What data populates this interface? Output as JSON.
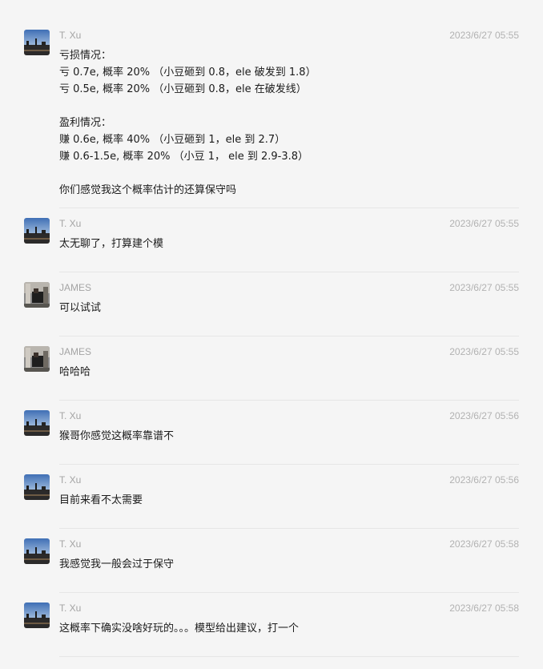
{
  "colors": {
    "background": "#f5f5f5",
    "meta_text": "#a4a4a4",
    "message_text": "#1b1b1b",
    "divider": "#e6e6e6"
  },
  "messages": [
    {
      "sender": "T. Xu",
      "avatar": "txu-avatar",
      "time": "2023/6/27 05:55",
      "lines": [
        "亏损情况：",
        "亏 0.7e, 概率 20% （小豆砸到 0.8，ele 破发到 1.8）",
        "亏 0.5e, 概率 20% （小豆砸到 0.8，ele 在破发线）",
        "",
        "盈利情况：",
        "赚 0.6e, 概率 40% （小豆砸到 1，ele 到 2.7）",
        "赚 0.6-1.5e, 概率 20% （小豆 1， ele 到 2.9-3.8）",
        "",
        "你们感觉我这个概率估计的还算保守吗"
      ]
    },
    {
      "sender": "T. Xu",
      "avatar": "txu-avatar",
      "time": "2023/6/27 05:55",
      "lines": [
        "太无聊了，打算建个模"
      ]
    },
    {
      "sender": "JAMES",
      "avatar": "james-avatar",
      "time": "2023/6/27 05:55",
      "lines": [
        "可以试试"
      ]
    },
    {
      "sender": "JAMES",
      "avatar": "james-avatar",
      "time": "2023/6/27 05:55",
      "lines": [
        "哈哈哈"
      ]
    },
    {
      "sender": "T. Xu",
      "avatar": "txu-avatar",
      "time": "2023/6/27 05:56",
      "lines": [
        "猴哥你感觉这概率靠谱不"
      ]
    },
    {
      "sender": "T. Xu",
      "avatar": "txu-avatar",
      "time": "2023/6/27 05:56",
      "lines": [
        "目前来看不太需要"
      ]
    },
    {
      "sender": "T. Xu",
      "avatar": "txu-avatar",
      "time": "2023/6/27 05:58",
      "lines": [
        "我感觉我一般会过于保守"
      ]
    },
    {
      "sender": "T. Xu",
      "avatar": "txu-avatar",
      "time": "2023/6/27 05:58",
      "lines": [
        "这概率下确实没啥好玩的。。。模型给出建议，打一个"
      ]
    }
  ]
}
